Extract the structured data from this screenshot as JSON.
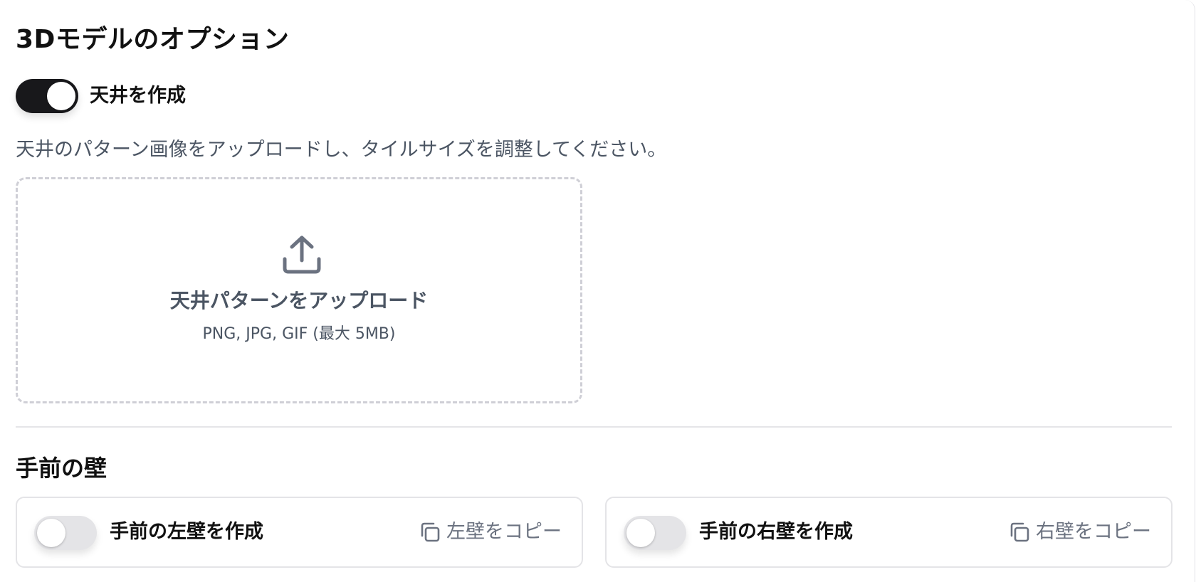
{
  "section": {
    "title": "3Dモデルのオプション"
  },
  "ceiling": {
    "toggle_label": "天井を作成",
    "toggle_on": true,
    "description": "天井のパターン画像をアップロードし、タイルサイズを調整してください。",
    "upload": {
      "title": "天井パターンをアップロード",
      "formats": "PNG, JPG, GIF (最大 5MB)",
      "icon": "upload-icon"
    }
  },
  "front_walls": {
    "title": "手前の壁",
    "left": {
      "toggle_label": "手前の左壁を作成",
      "toggle_on": false,
      "copy_label": "左壁をコピー",
      "icon": "copy-icon"
    },
    "right": {
      "toggle_label": "手前の右壁を作成",
      "toggle_on": false,
      "copy_label": "右壁をコピー",
      "icon": "copy-icon"
    }
  },
  "colors": {
    "toggle_on": "#18181b",
    "toggle_off": "#e4e4e7",
    "muted_text": "#6b7280",
    "dashed_border": "#cfcfd6"
  }
}
